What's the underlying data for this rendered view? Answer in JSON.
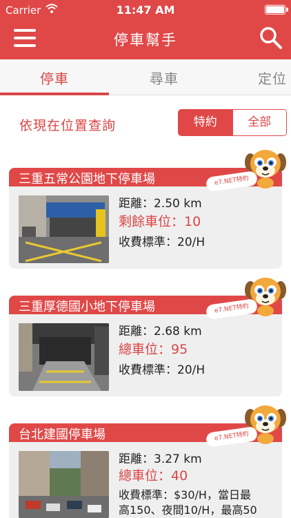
{
  "status_bar": {
    "carrier": "Carrier",
    "time": "11:47 AM"
  },
  "header": {
    "title": "停車幫手"
  },
  "tabs": [
    {
      "label": "停車",
      "active": true
    },
    {
      "label": "尋車",
      "active": false
    },
    {
      "label": "定位",
      "active": false
    }
  ],
  "filter": {
    "label": "依現在位置查詢",
    "options": [
      "特約",
      "全部"
    ],
    "selected": "特約"
  },
  "tag_text": "e7.NET特約",
  "parking_lots": [
    {
      "name": "三重五常公園地下停車場",
      "distance": "距離：2.50 km",
      "spaces": "剩餘車位：10",
      "fee": "收費標準：20/H",
      "fee_more": ""
    },
    {
      "name": "三重厚德國小地下停車場",
      "distance": "距離：2.68 km",
      "spaces": "總車位：95",
      "fee": "收費標準：20/H",
      "fee_more": ""
    },
    {
      "name": "台北建國停車場",
      "distance": "距離：3.27 km",
      "spaces": "總車位：40",
      "fee": "收費標準：$30/H，當日最",
      "fee_more": "高150、夜間10/H，最高50"
    }
  ],
  "colors": {
    "brand_red": "#e04848",
    "text_red": "#d94646",
    "card_bg": "#efefef"
  }
}
